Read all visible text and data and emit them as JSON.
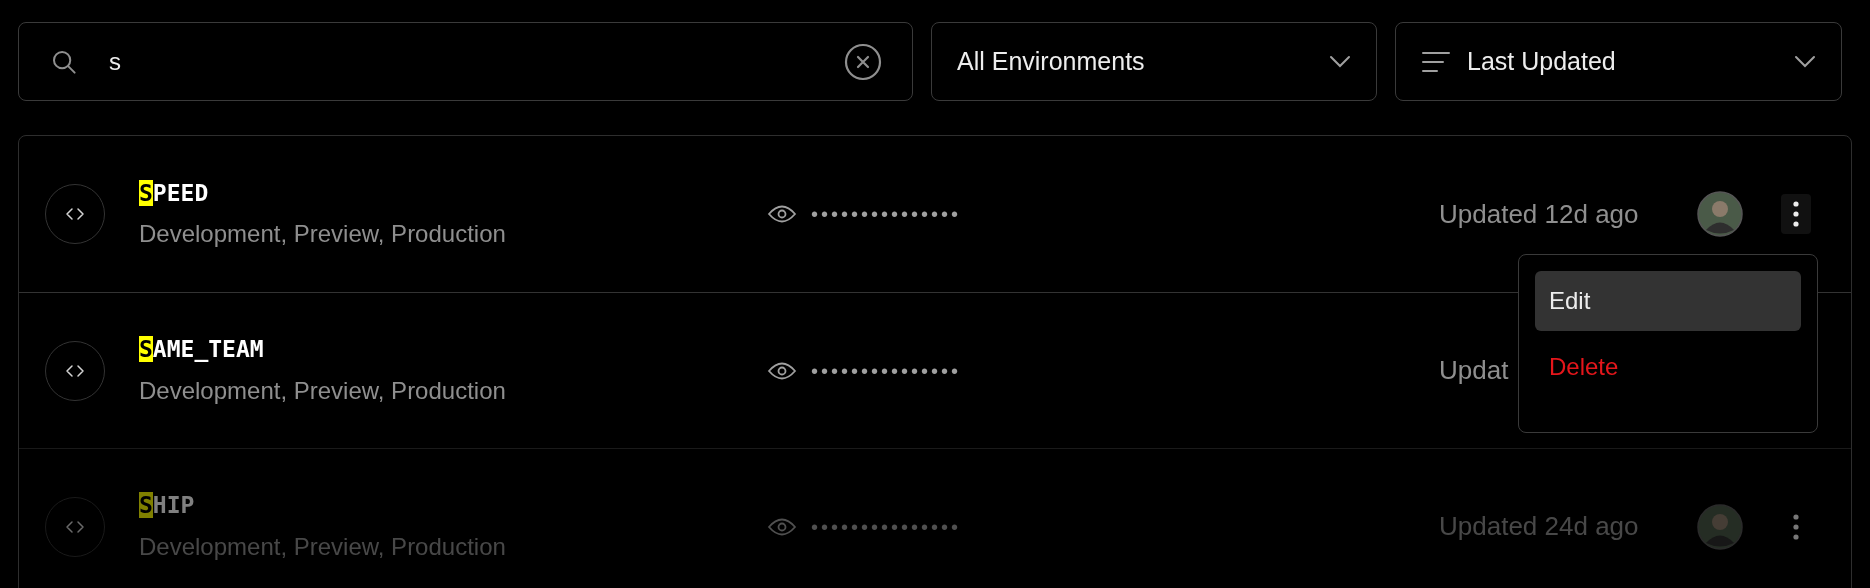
{
  "search": {
    "value": "s"
  },
  "environment_filter": {
    "label": "All Environments"
  },
  "sort": {
    "label": "Last Updated"
  },
  "variables": [
    {
      "match": "S",
      "rest": "PEED",
      "environments": "Development, Preview, Production",
      "value": "•••••••••••••••",
      "updated": "Updated 12d ago",
      "menu_open": true,
      "disabled": false
    },
    {
      "match": "S",
      "rest": "AME_TEAM",
      "environments": "Development, Preview, Production",
      "value": "•••••••••••••••",
      "updated": "Updat",
      "menu_open": false,
      "disabled": false
    },
    {
      "match": "S",
      "rest": "HIP",
      "environments": "Development, Preview, Production",
      "value": "•••••••••••••••",
      "updated": "Updated 24d ago",
      "menu_open": false,
      "disabled": true
    }
  ],
  "menu": [
    {
      "label": "Edit",
      "kind": "normal",
      "selected": true
    },
    {
      "label": "Delete",
      "kind": "danger",
      "selected": false
    }
  ]
}
